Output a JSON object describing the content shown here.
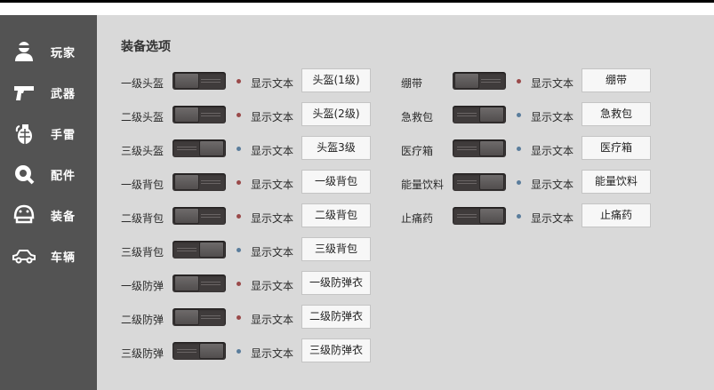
{
  "sidebar": {
    "items": [
      {
        "label": "玩家",
        "icon": "player-icon"
      },
      {
        "label": "武器",
        "icon": "pistol-icon"
      },
      {
        "label": "手雷",
        "icon": "grenade-icon"
      },
      {
        "label": "配件",
        "icon": "wrench-gear-icon"
      },
      {
        "label": "装备",
        "icon": "helmet-icon"
      },
      {
        "label": "车辆",
        "icon": "car-icon"
      }
    ]
  },
  "main": {
    "title": "装备选项",
    "col1": [
      {
        "name": "一级头盔",
        "toggle": "off",
        "dot": "red",
        "label": "显示文本",
        "value": "头盔(1级)"
      },
      {
        "name": "二级头盔",
        "toggle": "off",
        "dot": "red",
        "label": "显示文本",
        "value": "头盔(2级)"
      },
      {
        "name": "三级头盔",
        "toggle": "on",
        "dot": "blue",
        "label": "显示文本",
        "value": "头盔3级"
      },
      {
        "name": "一级背包",
        "toggle": "off",
        "dot": "red",
        "label": "显示文本",
        "value": "一级背包"
      },
      {
        "name": "二级背包",
        "toggle": "off",
        "dot": "red",
        "label": "显示文本",
        "value": "二级背包"
      },
      {
        "name": "三级背包",
        "toggle": "on",
        "dot": "blue",
        "label": "显示文本",
        "value": "三级背包"
      },
      {
        "name": "一级防弹",
        "toggle": "off",
        "dot": "red",
        "label": "显示文本",
        "value": "一级防弹衣"
      },
      {
        "name": "二级防弹",
        "toggle": "off",
        "dot": "red",
        "label": "显示文本",
        "value": "二级防弹衣"
      },
      {
        "name": "三级防弹",
        "toggle": "on",
        "dot": "blue",
        "label": "显示文本",
        "value": "三级防弹衣"
      }
    ],
    "col2": [
      {
        "name": "绷带",
        "toggle": "off",
        "dot": "red",
        "label": "显示文本",
        "value": "绷带"
      },
      {
        "name": "急救包",
        "toggle": "on",
        "dot": "blue",
        "label": "显示文本",
        "value": "急救包"
      },
      {
        "name": "医疗箱",
        "toggle": "on",
        "dot": "blue",
        "label": "显示文本",
        "value": "医疗箱"
      },
      {
        "name": "能量饮料",
        "toggle": "on",
        "dot": "blue",
        "label": "显示文本",
        "value": "能量饮料"
      },
      {
        "name": "止痛药",
        "toggle": "on",
        "dot": "blue",
        "label": "显示文本",
        "value": "止痛药"
      }
    ]
  },
  "colors": {
    "sidebar": "#535353",
    "main": "#d9d9d9",
    "dot_off": "#9a4a4a",
    "dot_on": "#5a7d9c"
  }
}
